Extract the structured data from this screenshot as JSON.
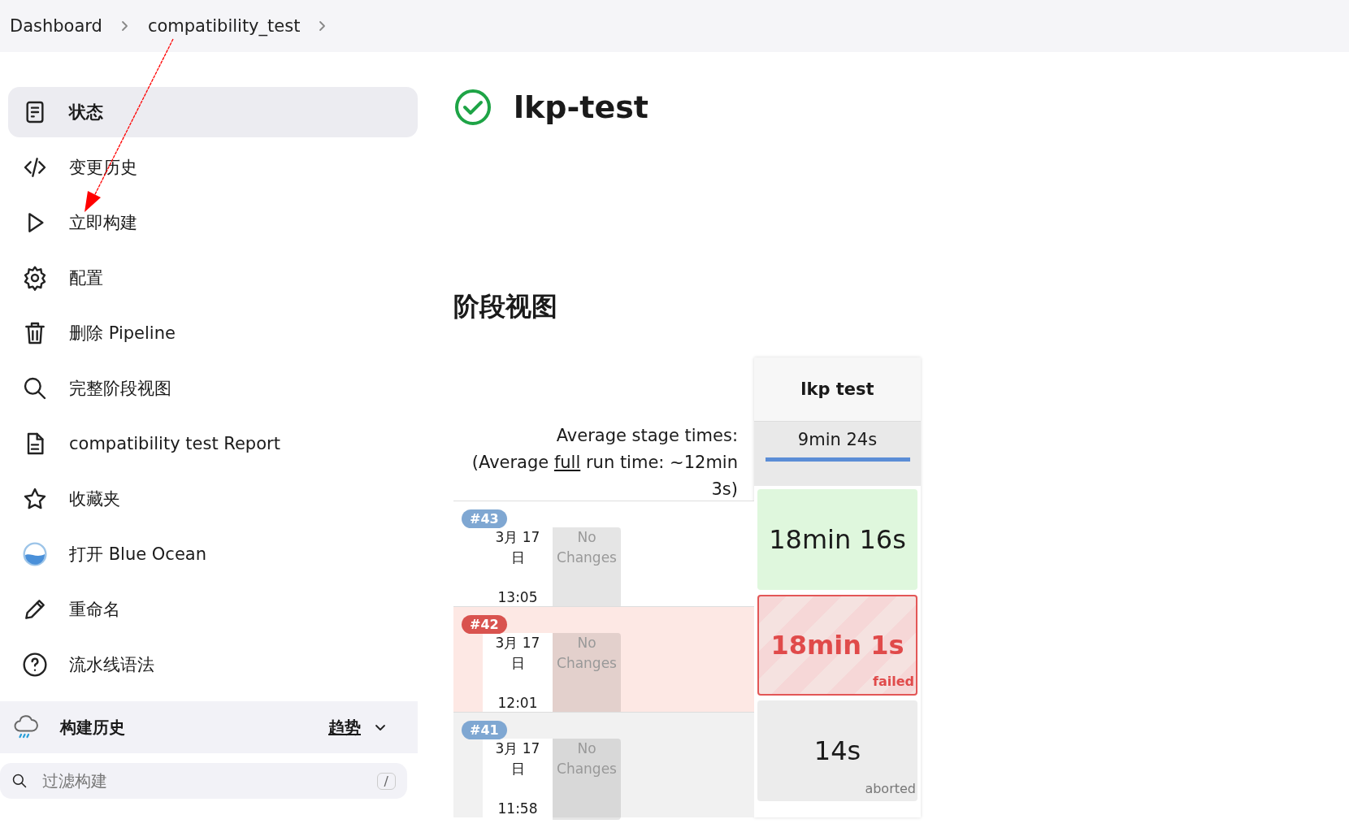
{
  "breadcrumbs": [
    "Dashboard",
    "compatibility_test"
  ],
  "sidebar": {
    "items": [
      {
        "label": "状态",
        "selected": true
      },
      {
        "label": "变更历史",
        "selected": false
      },
      {
        "label": "立即构建",
        "selected": false
      },
      {
        "label": "配置",
        "selected": false
      },
      {
        "label": "删除 Pipeline",
        "selected": false
      },
      {
        "label": "完整阶段视图",
        "selected": false
      },
      {
        "label": "compatibility test Report",
        "selected": false
      },
      {
        "label": "收藏夹",
        "selected": false
      },
      {
        "label": "打开 Blue Ocean",
        "selected": false
      },
      {
        "label": "重命名",
        "selected": false
      },
      {
        "label": "流水线语法",
        "selected": false
      }
    ]
  },
  "build_history": {
    "title": "构建历史",
    "trend": "趋势",
    "expanded": false,
    "filter": {
      "placeholder": "过滤构建",
      "shortcut": "/"
    }
  },
  "job": {
    "title": "lkp-test",
    "kind": "success"
  },
  "stage_view": {
    "title": "阶段视图",
    "average": {
      "label": "Average stage times:",
      "before": "(Average",
      "link": "full",
      "after": "run time: ~12min 3s)"
    },
    "stages": [
      {
        "name": "lkp test",
        "average": "9min 24s",
        "level": 1
      }
    ],
    "builds": [
      {
        "number": "#43",
        "kind": "success",
        "date": "3月 17 日",
        "time": "13:05",
        "changes": "No Changes",
        "durations": [
          {
            "text": "18min 16s"
          }
        ]
      },
      {
        "number": "#42",
        "kind": "failed",
        "date": "3月 17 日",
        "time": "12:01",
        "changes": "No Changes",
        "durations": [
          {
            "text": "18min 1s",
            "result": "failed"
          }
        ]
      },
      {
        "number": "#41",
        "kind": "aborted",
        "date": "3月 17 日",
        "time": "11:58",
        "changes": "No Changes",
        "durations": [
          {
            "text": "14s",
            "result": "aborted"
          }
        ]
      }
    ]
  },
  "annotation": {
    "kind": "arrow"
  }
}
